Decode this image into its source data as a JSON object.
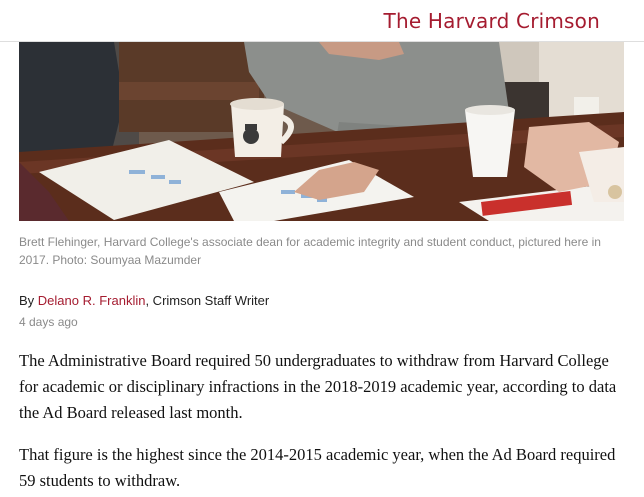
{
  "header": {
    "site_title": "The Harvard Crimson"
  },
  "photo": {
    "caption": "Brett Flehinger, Harvard College's associate dean for academic integrity and student conduct, pictured here in 2017. Photo: Soumyaa Mazumder"
  },
  "article": {
    "byline_prefix": "By ",
    "author": "Delano R. Franklin",
    "author_role": ", Crimson Staff Writer",
    "timestamp": "4 days ago",
    "paragraphs": [
      "The Administrative Board required 50 undergraduates to withdraw from Harvard College for academic or disciplinary infractions in the 2018-2019 academic year, according to data the Ad Board released last month.",
      "That figure is the highest since the 2014-2015 academic year, when the Ad Board required 59 students to withdraw."
    ]
  },
  "colors": {
    "brand": "#a51c30",
    "muted_text": "#8a8a8a"
  }
}
